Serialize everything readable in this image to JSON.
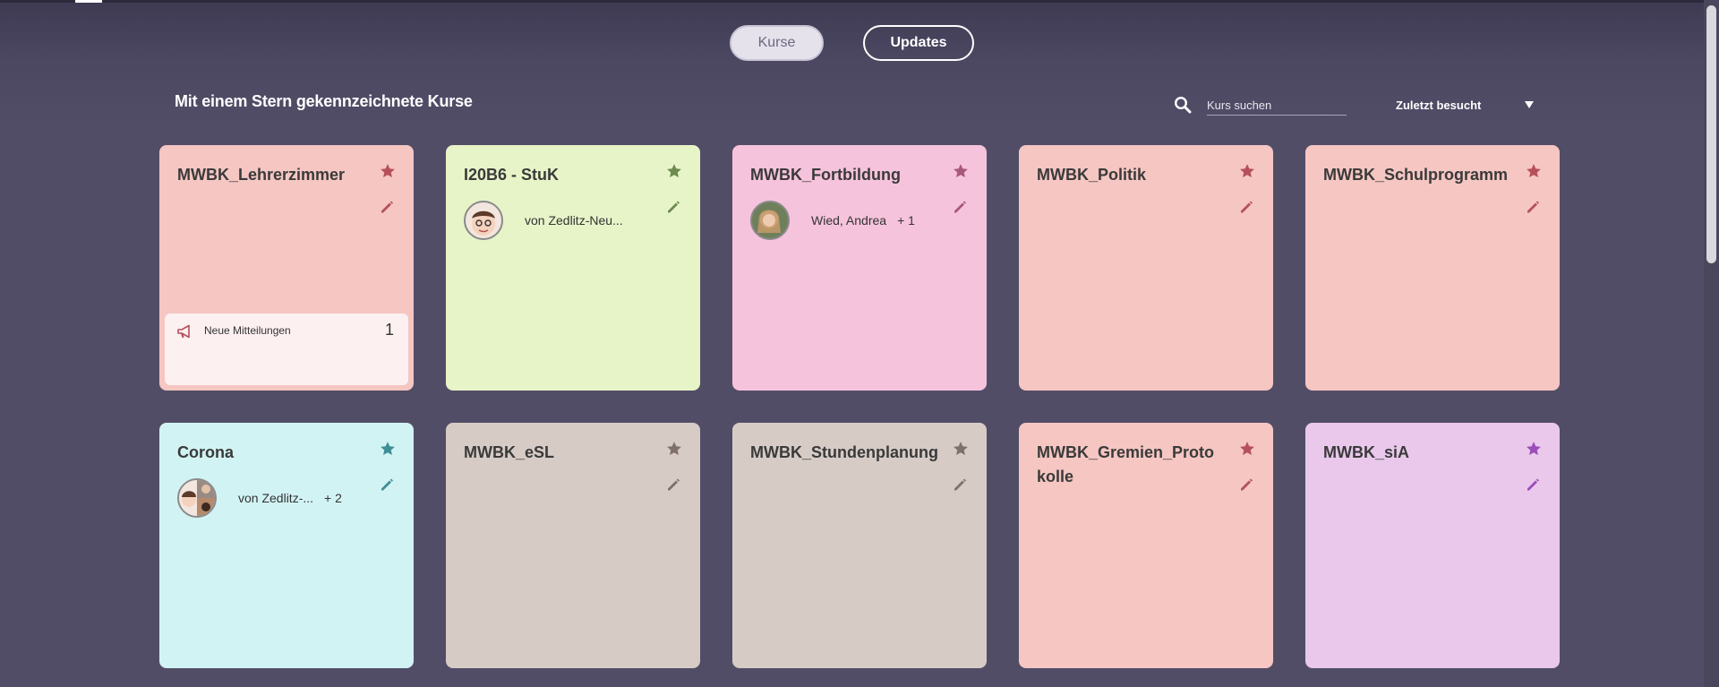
{
  "tabs": {
    "kurse": "Kurse",
    "updates": "Updates"
  },
  "section": {
    "title": "Mit einem Stern gekennzeichnete Kurse"
  },
  "search": {
    "placeholder": "Kurs suchen",
    "value": ""
  },
  "sort": {
    "selected": "Zuletzt besucht"
  },
  "colors": {
    "pink": "#f5c6c2",
    "green": "#e7f4c8",
    "magenta": "#f6c3dc",
    "cyan": "#d2f3f4",
    "taupe": "#d7cbc6",
    "lavender": "#e9c8ec",
    "star_red": "#b5505b",
    "star_green": "#6e8a4f",
    "star_pink": "#a8587a",
    "star_teal": "#3f8f96",
    "star_grey": "#7f706c",
    "star_purple": "#9b4db8"
  },
  "cards": [
    {
      "title": "MWBK_Lehrerzimmer",
      "notice": {
        "label": "Neue Mitteilungen",
        "count": "1"
      }
    },
    {
      "title": "I20B6 - StuK",
      "owner": {
        "name": "von Zedlitz-Neu...",
        "extra": ""
      }
    },
    {
      "title": "MWBK_Fortbildung",
      "owner": {
        "name": "Wied, Andrea",
        "extra": "+ 1"
      }
    },
    {
      "title": "MWBK_Politik"
    },
    {
      "title": "MWBK_Schulprogramm"
    },
    {
      "title": "Corona",
      "owner": {
        "name": "von Zedlitz-...",
        "extra": "+ 2"
      }
    },
    {
      "title": "MWBK_eSL"
    },
    {
      "title": "MWBK_Stundenplanung"
    },
    {
      "title": "MWBK_Gremien_Protokolle"
    },
    {
      "title": "MWBK_siA"
    }
  ]
}
